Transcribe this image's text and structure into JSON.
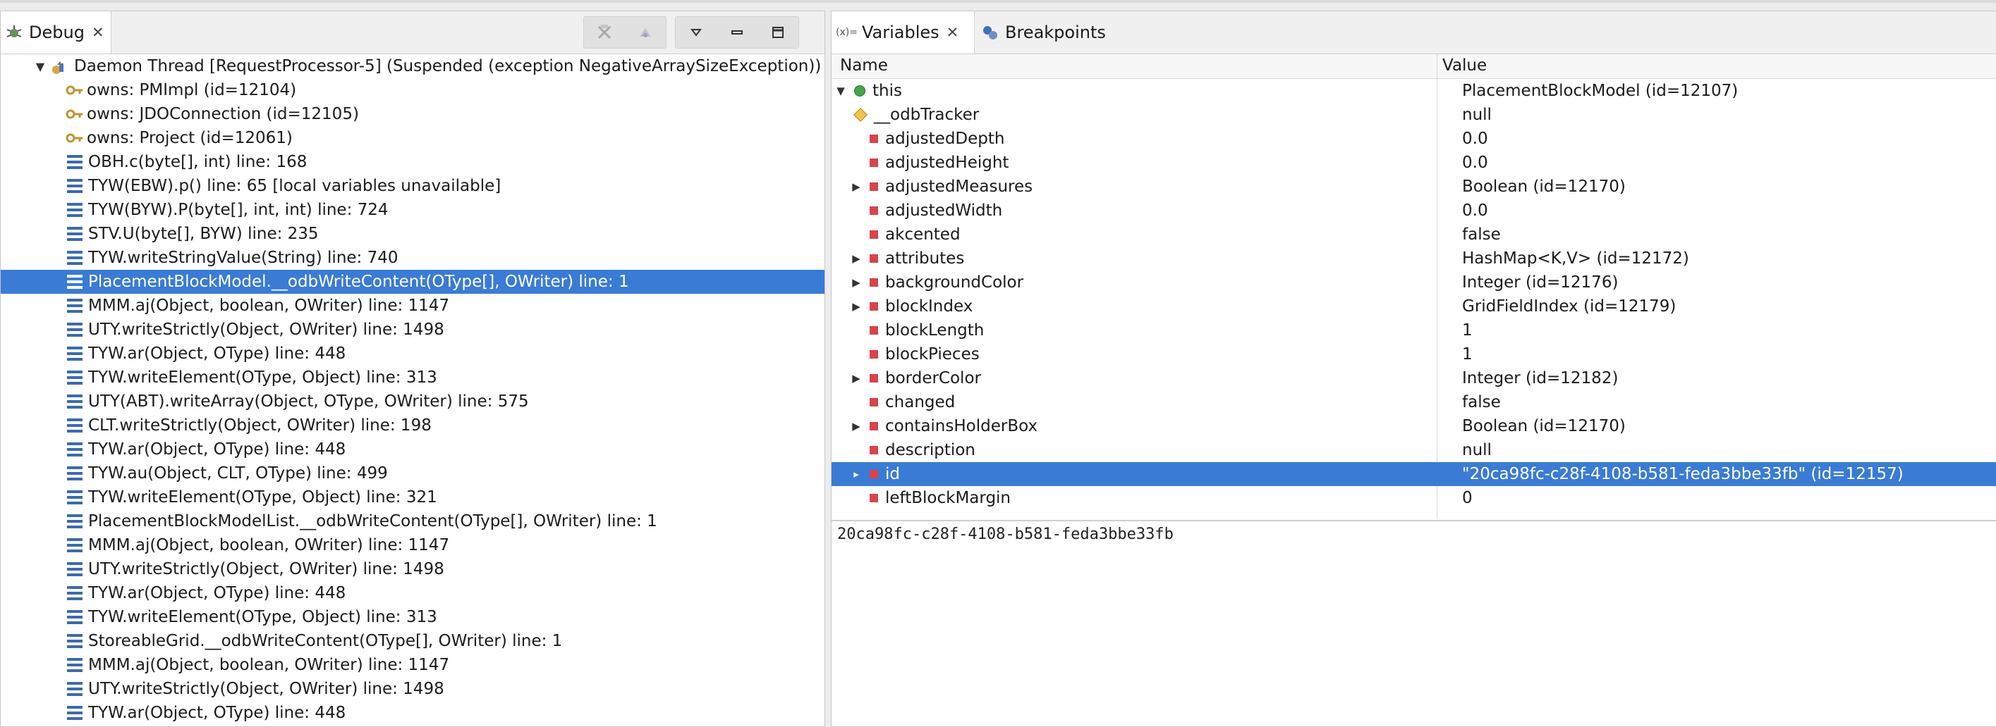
{
  "debug_view": {
    "tab_label": "Debug",
    "thread": "Daemon Thread [RequestProcessor-5] (Suspended (exception NegativeArraySizeException))",
    "monitors": [
      "owns: PMImpl  (id=12104)",
      "owns: JDOConnection  (id=12105)",
      "owns: Project  (id=12061)"
    ],
    "frames": [
      "OBH.c(byte[], int) line: 168",
      "TYW(EBW).p() line: 65 [local variables unavailable]",
      "TYW(BYW).P(byte[], int, int) line: 724",
      "STV.U(byte[], BYW) line: 235",
      "TYW.writeStringValue(String) line: 740",
      "PlacementBlockModel.__odbWriteContent(OType[], OWriter) line: 1",
      "MMM.aj(Object, boolean, OWriter) line: 1147",
      "UTY.writeStrictly(Object, OWriter) line: 1498",
      "TYW.ar(Object, OType) line: 448",
      "TYW.writeElement(OType, Object) line: 313",
      "UTY(ABT).writeArray(Object, OType, OWriter) line: 575",
      "CLT.writeStrictly(Object, OWriter) line: 198",
      "TYW.ar(Object, OType) line: 448",
      "TYW.au(Object, CLT, OType) line: 499",
      "TYW.writeElement(OType, Object) line: 321",
      "PlacementBlockModelList.__odbWriteContent(OType[], OWriter) line: 1",
      "MMM.aj(Object, boolean, OWriter) line: 1147",
      "UTY.writeStrictly(Object, OWriter) line: 1498",
      "TYW.ar(Object, OType) line: 448",
      "TYW.writeElement(OType, Object) line: 313",
      "StoreableGrid.__odbWriteContent(OType[], OWriter) line: 1",
      "MMM.aj(Object, boolean, OWriter) line: 1147",
      "UTY.writeStrictly(Object, OWriter) line: 1498",
      "TYW.ar(Object, OType) line: 448"
    ]
  },
  "variables_view": {
    "tab_label": "Variables",
    "tab_icon_text": "(x)=",
    "breakpoints_label": "Breakpoints",
    "col_name": "Name",
    "col_value": "Value",
    "rows": [
      {
        "name": "this",
        "value": "PlacementBlockModel  (id=12107)"
      },
      {
        "name": "__odbTracker",
        "value": "null"
      },
      {
        "name": "adjustedDepth",
        "value": "0.0"
      },
      {
        "name": "adjustedHeight",
        "value": "0.0"
      },
      {
        "name": "adjustedMeasures",
        "value": "Boolean  (id=12170)"
      },
      {
        "name": "adjustedWidth",
        "value": "0.0"
      },
      {
        "name": "akcented",
        "value": "false"
      },
      {
        "name": "attributes",
        "value": "HashMap<K,V>  (id=12172)"
      },
      {
        "name": "backgroundColor",
        "value": "Integer  (id=12176)"
      },
      {
        "name": "blockIndex",
        "value": "GridFieldIndex  (id=12179)"
      },
      {
        "name": "blockLength",
        "value": "1"
      },
      {
        "name": "blockPieces",
        "value": "1"
      },
      {
        "name": "borderColor",
        "value": "Integer  (id=12182)"
      },
      {
        "name": "changed",
        "value": "false"
      },
      {
        "name": "containsHolderBox",
        "value": "Boolean  (id=12170)"
      },
      {
        "name": "description",
        "value": "null"
      },
      {
        "name": "id",
        "value": "\"20ca98fc-c28f-4108-b581-feda3bbe33fb\" (id=12157)"
      },
      {
        "name": "leftBlockMargin",
        "value": "0"
      }
    ],
    "detail_text": "20ca98fc-c28f-4108-b581-feda3bbe33fb"
  },
  "colors": {
    "selection": "#3a7bd5",
    "field_icon": "#d9434a",
    "stack_icon": "#3b6ab0"
  }
}
